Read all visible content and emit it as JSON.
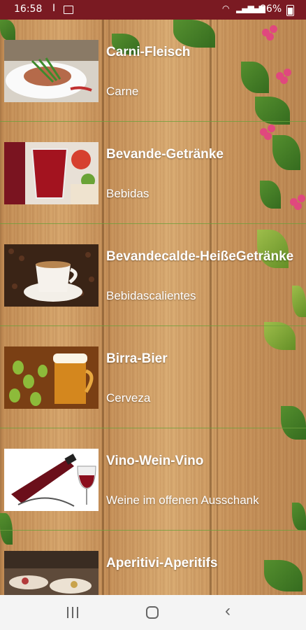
{
  "status_bar": {
    "time": "16:58",
    "separator": "I",
    "battery": "86%"
  },
  "menu": {
    "items": [
      {
        "title": "Carni-Fleisch",
        "subtitle": "Carne",
        "image": "meat-dish-photo"
      },
      {
        "title": "Bevande-Getränke",
        "subtitle": "Bebidas",
        "image": "sangria-drinks-photo"
      },
      {
        "title": "Bevandecalde-HeißeGetränke",
        "subtitle": "Bebidascalientes",
        "image": "coffee-cup-photo"
      },
      {
        "title": "Birra-Bier",
        "subtitle": "Cerveza",
        "image": "beer-mug-hops-photo"
      },
      {
        "title": "Vino-Wein-Vino",
        "subtitle": "Weine im offenen Ausschank",
        "image": "red-wine-bottle-glass-photo"
      },
      {
        "title": "Aperitivi-Aperitifs",
        "subtitle": "",
        "image": "aperitif-buffet-photo"
      }
    ]
  },
  "colors": {
    "status_bar": "#7a1a22",
    "wood": "#c9945a",
    "divider": "#6ea03c",
    "text": "#ffffff"
  }
}
